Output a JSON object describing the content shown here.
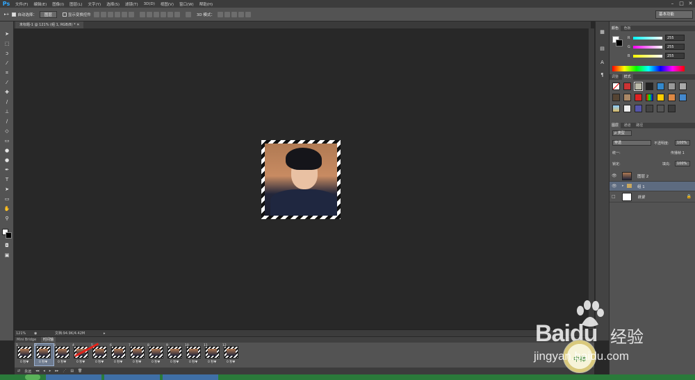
{
  "menubar": {
    "logo": "Ps",
    "items": [
      "文件(F)",
      "编辑(E)",
      "图像(I)",
      "图层(L)",
      "文字(Y)",
      "选择(S)",
      "滤镜(T)",
      "3D(D)",
      "视图(V)",
      "窗口(W)",
      "帮助(H)"
    ],
    "min": "–",
    "max": "□",
    "close": "✕"
  },
  "options": {
    "auto_select": "自动选择：",
    "group": "图层",
    "transform": "显示变换控件",
    "mode3d": "3D 模式：",
    "workspace": "基本功能"
  },
  "doc_tab": "未标题-1 @ 121% (组 1, RGB/8) *",
  "status": {
    "zoom": "121%",
    "doc": "文档:94.9K/4.42M"
  },
  "timeline": {
    "tabs": [
      "Mini Bridge",
      "时间轴"
    ],
    "frames": [
      "1",
      "2",
      "3",
      "4",
      "5",
      "6",
      "7",
      "8",
      "9",
      "10",
      "11",
      "12"
    ],
    "duration": "0 秒▼",
    "loop": "永远"
  },
  "color_panel": {
    "tabs": [
      "颜色",
      "色板"
    ],
    "r_label": "R",
    "g_label": "G",
    "b_label": "B",
    "r": "255",
    "g": "255",
    "b": "255"
  },
  "styles_panel": {
    "tabs": [
      "调整",
      "样式"
    ]
  },
  "layers_panel": {
    "tabs": [
      "图层",
      "通道",
      "路径"
    ],
    "kind": "ρ 类型",
    "blend": "穿透",
    "opacity_label": "不透明度:",
    "opacity": "100%",
    "unify": "统一:",
    "propagate": "传播帧 1",
    "lock_label": "锁定:",
    "fill_label": "填充:",
    "fill": "100%",
    "layers": [
      {
        "name": "图层 2"
      },
      {
        "name": "组 1"
      },
      {
        "name": "背景"
      }
    ]
  },
  "watermark": {
    "logo": "Baidu",
    "brand": "经验",
    "url": "jingyan.baidu.com",
    "seal": "中禅"
  },
  "colors": {
    "accent": "#31a8ff",
    "selection": "#5d6b80",
    "arrow": "#e0241c"
  }
}
